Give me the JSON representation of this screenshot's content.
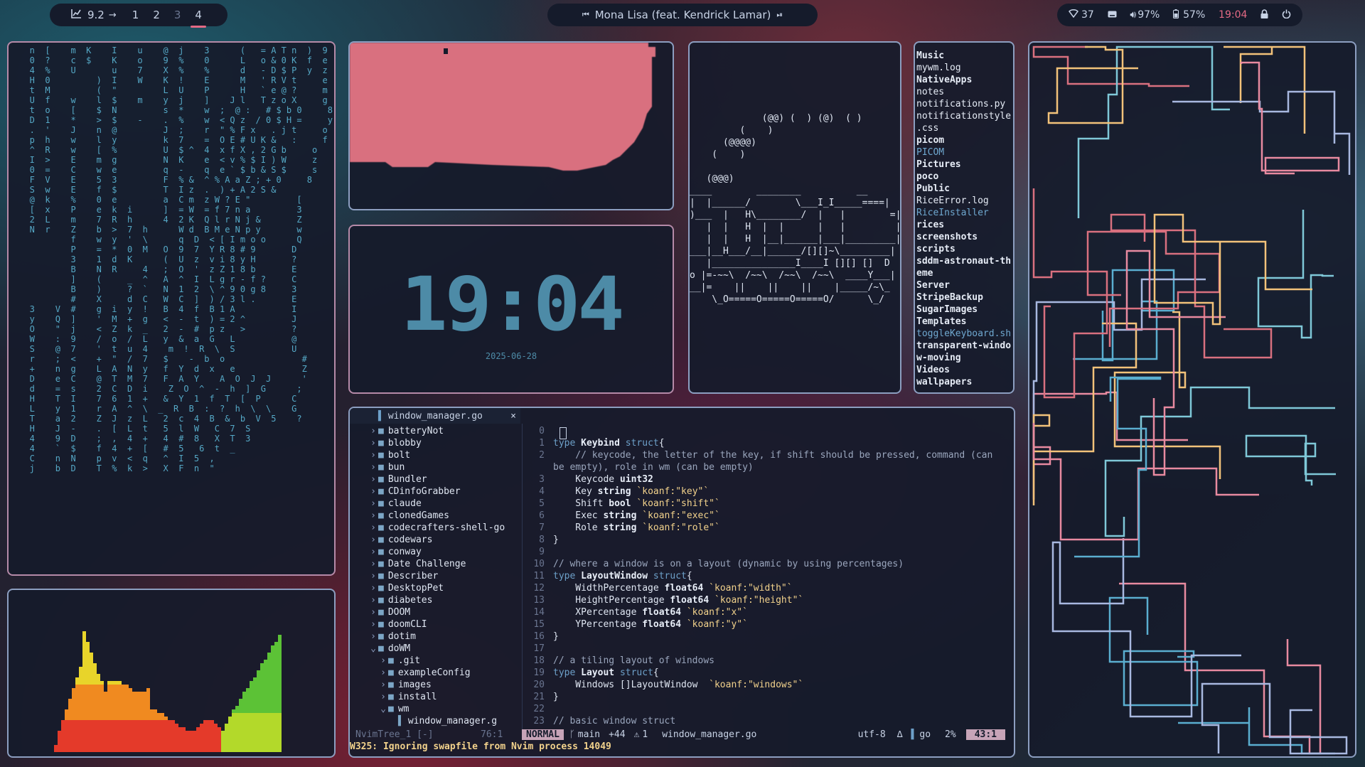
{
  "topbar": {
    "left": {
      "chart_icon": "chart-line-icon",
      "load": "9.2",
      "arrow": "→",
      "workspaces": [
        {
          "label": "1",
          "state": "normal"
        },
        {
          "label": "2",
          "state": "normal"
        },
        {
          "label": "3",
          "state": "dim"
        },
        {
          "label": "4",
          "state": "active"
        }
      ]
    },
    "media": {
      "prev_icon": "prev-track-icon",
      "title": "Mona Lisa (feat. Kendrick Lamar)",
      "next_icon": "play-next-icon"
    },
    "status": {
      "network_value": "37",
      "volume_value": "97%",
      "battery_value": "57%",
      "time": "19:04",
      "accent": "#e46a85"
    }
  },
  "matrix_lines": [
    "   n  [    m  K    I    u    @  j    3      (   = A T n  )  9",
    "   0  ?    c  $    K    o    9  %    0      L   o & 0 K  f  e",
    "   4  %    U       u    7    X  %    %      d   - D $ P  y  z",
    "   H  0         )  I    W    K  !    E      M   ' R V t     e",
    "   t  M         (  \"         L  U    P      H   ` e @ ?     m",
    "   U  f    w    l  $    m    y  j    ]    J l   T z o X     g",
    "   t  o    [    $  N         s  *    w  ;  @ :   # $ b 0     8",
    "   D  1    *    >  $    -    .  %    w  < Q z  / 0 $ H =     y",
    "   .  '    J    n  @         J  ;    r  \" % F x   . j t     o",
    "   p  h    w    l  y         k  7    =  O E # U K &   :     f",
    "   ^  R    w    [  %         U  $ ^  4  x f X , 2 G b     o",
    "   I  >    E    m  g         N  K    e  < v % $ I ) W     z",
    "   0  =    C    w  e         q  -    q  e ` $ b & S $     s",
    "   F  V    E    5  3         F  % &  ^ % A a Z ; + 0     8",
    "   S  w    E    f  $         T  I z  .  ) + A 2 S &",
    "   @  k    %    0  e         a  C m  z W ? E \"         [",
    "   [  x    P    e  k  i      ]  = W  = f 7 n a         3",
    "   2  L    m    7  R  h      4  2 K  Q l r N j &       Z",
    "   N  r    Z    b  >  7  h      W d  B M e N p y       w",
    "           f    w  y  '  \\      q  D  < [ I m o o      Q",
    "           P    =  *  0  M   O  9  7  Y R 8 # 9       D",
    "           3    1  d  K      (  U  z  v i 8 y H       ?",
    "           B    N  R     4   ;  O  '  z Z 1 8 b       E",
    "           ]    (     _  ^   A  ^  I  L g r - f ?     C",
    "           B    )     ?  `   N  1  2  \\ ^ 9 0 g 8     3",
    "           #    X     d  C   W  C  ]  ) / 3 l .       E",
    "   3    V  #    g  i  y  !   B  4  f  B 1 A           I",
    "   y    Q  ]    '  M  +  g   <  -  t  ) = 2 ^         J",
    "   O    \"  j    <  Z  k  _   2  -  #  p z   >         ?",
    "   W    :  9    /  o  /  L   y  &  a  G   L           @",
    "   S    @  7    '  t  u  4    m  !  R  \\  S           U",
    "   r    ;  <    +  \"  /  7   $    -  b  o               #",
    "   +    n  g    L  A  N  y   f  Y  d  x   e             Z",
    "   D    e  C    @  T  M  7   F  A  Y    A  O  J  J      '",
    "   d    =  s    2  C  D  i    Z  O  ^  -  h  ]  G      ;",
    "   H    T  I    7  6  1  +   &  Y  1  f  T  [  P      C",
    "   L    y  1    r  A  ^  \\  _  R  B  :  ?  h  \\  \\    G",
    "   T    a  2    Z  J  z  L   2  c  4  B  &  b  V  5    ?",
    "   H    J  -    .  [  L  t   5  l  W   C  7  S",
    "   4    9  D    ;  ,  4  +   4  #  8   X  T  3",
    "   4    `  $    f  4  +  [   #  5   6  t  _",
    "   C    n  N    p  v  <  q   ^  I  5  ,",
    "   j    b  D    T  %  k  >   X  F  n  \""
  ],
  "clock": {
    "time": "19:04",
    "date": "2025-06-28"
  },
  "ascii_art": [
    "",
    "",
    "             (@@) (  ) (@)  ( )",
    "         (    )",
    "      (@@@@)",
    "    (    )",
    "",
    "   (@@@)",
    "____        ________          __",
    "|  |______/        \\___I_I_____====|",
    ")___  |   H\\________/  |   |        =|",
    "   |  |   H  |  |      |   |         |",
    "   |  |   H  |__|______|___|_________|",
    "___|__H___/__|______/[][]~\\_________|",
    "   |_______________I____I [][] []  D  |",
    "o |=-~~\\  /~~\\  /~~\\  /~~\\  ____Y___|",
    "__|=    ||    ||    ||    |_____/~\\_",
    "    \\_O=====O=====O=====O/      \\_/"
  ],
  "file_list": [
    {
      "name": "Music",
      "style": "dir"
    },
    {
      "name": "mywm.log",
      "style": "plain"
    },
    {
      "name": "NativeApps",
      "style": "dir"
    },
    {
      "name": "notes",
      "style": "plain"
    },
    {
      "name": "notifications.py",
      "style": "plain"
    },
    {
      "name": "notificationstyle",
      "style": "plain"
    },
    {
      "name": ".css",
      "style": "plain"
    },
    {
      "name": "picom",
      "style": "dir"
    },
    {
      "name": "PICOM",
      "style": "hi"
    },
    {
      "name": "Pictures",
      "style": "dir"
    },
    {
      "name": "poco",
      "style": "dir"
    },
    {
      "name": "Public",
      "style": "dir"
    },
    {
      "name": "RiceError.log",
      "style": "plain"
    },
    {
      "name": "RiceInstaller",
      "style": "hi"
    },
    {
      "name": "rices",
      "style": "dir"
    },
    {
      "name": "screenshots",
      "style": "dir"
    },
    {
      "name": "scripts",
      "style": "dir"
    },
    {
      "name": "sddm-astronaut-th",
      "style": "dir"
    },
    {
      "name": "eme",
      "style": "dir"
    },
    {
      "name": "Server",
      "style": "dir"
    },
    {
      "name": "StripeBackup",
      "style": "dir"
    },
    {
      "name": "SugarImages",
      "style": "dir"
    },
    {
      "name": "Templates",
      "style": "dir"
    },
    {
      "name": "toggleKeyboard.sh",
      "style": "hi"
    },
    {
      "name": "transparent-windo",
      "style": "dir"
    },
    {
      "name": "w-moving",
      "style": "dir"
    },
    {
      "name": "Videos",
      "style": "dir"
    },
    {
      "name": "wallpapers",
      "style": "dir"
    }
  ],
  "editor": {
    "tab": {
      "file_icon": "go-file-icon",
      "label": "window_manager.go",
      "close": "×"
    },
    "tree": [
      {
        "label": "batteryNot",
        "depth": 0,
        "open": false
      },
      {
        "label": "blobby",
        "depth": 0,
        "open": false
      },
      {
        "label": "bolt",
        "depth": 0,
        "open": false
      },
      {
        "label": "bun",
        "depth": 0,
        "open": false
      },
      {
        "label": "Bundler",
        "depth": 0,
        "open": false
      },
      {
        "label": "CDinfoGrabber",
        "depth": 0,
        "open": false
      },
      {
        "label": "claude",
        "depth": 0,
        "open": false
      },
      {
        "label": "clonedGames",
        "depth": 0,
        "open": false
      },
      {
        "label": "codecrafters-shell-go",
        "depth": 0,
        "open": false
      },
      {
        "label": "codewars",
        "depth": 0,
        "open": false
      },
      {
        "label": "conway",
        "depth": 0,
        "open": false
      },
      {
        "label": "Date Challenge",
        "depth": 0,
        "open": false
      },
      {
        "label": "Describer",
        "depth": 0,
        "open": false
      },
      {
        "label": "DesktopPet",
        "depth": 0,
        "open": false
      },
      {
        "label": "diabetes",
        "depth": 0,
        "open": false
      },
      {
        "label": "DOOM",
        "depth": 0,
        "open": false
      },
      {
        "label": "doomCLI",
        "depth": 0,
        "open": false
      },
      {
        "label": "dotim",
        "depth": 0,
        "open": false
      },
      {
        "label": "doWM",
        "depth": 0,
        "open": true
      },
      {
        "label": ".git",
        "depth": 1,
        "open": false
      },
      {
        "label": "exampleConfig",
        "depth": 1,
        "open": false
      },
      {
        "label": "images",
        "depth": 1,
        "open": false
      },
      {
        "label": "install",
        "depth": 1,
        "open": false
      },
      {
        "label": "wm",
        "depth": 1,
        "open": true
      },
      {
        "label": "window_manager.g",
        "depth": 2,
        "open": false,
        "file": true
      }
    ],
    "code": [
      {
        "n": "0",
        "t": [
          [
            "tx",
            ""
          ]
        ]
      },
      {
        "n": "1",
        "t": [
          [
            "kw",
            "type "
          ],
          [
            "ty",
            "Keybind "
          ],
          [
            "kw",
            "struct"
          ],
          [
            "tx",
            "{"
          ]
        ]
      },
      {
        "n": "2",
        "t": [
          [
            "cm",
            "    // keycode, the letter of the key, if shift should be pressed, command (can"
          ]
        ]
      },
      {
        "n": "",
        "t": [
          [
            "cm",
            "be empty), role in wm (can be empty)"
          ]
        ]
      },
      {
        "n": "3",
        "t": [
          [
            "tx",
            "    Keycode "
          ],
          [
            "ty",
            "uint32"
          ]
        ]
      },
      {
        "n": "4",
        "t": [
          [
            "tx",
            "    Key "
          ],
          [
            "ty",
            "string "
          ],
          [
            "tg",
            "`koanf:\"key\"`"
          ]
        ]
      },
      {
        "n": "5",
        "t": [
          [
            "tx",
            "    Shift "
          ],
          [
            "ty",
            "bool "
          ],
          [
            "tg",
            "`koanf:\"shift\"`"
          ]
        ]
      },
      {
        "n": "6",
        "t": [
          [
            "tx",
            "    Exec "
          ],
          [
            "ty",
            "string "
          ],
          [
            "tg",
            "`koanf:\"exec\"`"
          ]
        ]
      },
      {
        "n": "7",
        "t": [
          [
            "tx",
            "    Role "
          ],
          [
            "ty",
            "string "
          ],
          [
            "tg",
            "`koanf:\"role\"`"
          ]
        ]
      },
      {
        "n": "8",
        "t": [
          [
            "tx",
            "}"
          ]
        ]
      },
      {
        "n": "9",
        "t": [
          [
            "tx",
            ""
          ]
        ]
      },
      {
        "n": "10",
        "t": [
          [
            "cm",
            "// where a window is on a layout (dynamic by using percentages)"
          ]
        ]
      },
      {
        "n": "11",
        "t": [
          [
            "kw",
            "type "
          ],
          [
            "ty",
            "LayoutWindow "
          ],
          [
            "kw",
            "struct"
          ],
          [
            "tx",
            "{"
          ]
        ]
      },
      {
        "n": "12",
        "t": [
          [
            "tx",
            "    WidthPercentage "
          ],
          [
            "ty",
            "float64 "
          ],
          [
            "tg",
            "`koanf:\"width\"`"
          ]
        ]
      },
      {
        "n": "13",
        "t": [
          [
            "tx",
            "    HeightPercentage "
          ],
          [
            "ty",
            "float64 "
          ],
          [
            "tg",
            "`koanf:\"height\"`"
          ]
        ]
      },
      {
        "n": "14",
        "t": [
          [
            "tx",
            "    XPercentage "
          ],
          [
            "ty",
            "float64 "
          ],
          [
            "tg",
            "`koanf:\"x\"`"
          ]
        ]
      },
      {
        "n": "15",
        "t": [
          [
            "tx",
            "    YPercentage "
          ],
          [
            "ty",
            "float64 "
          ],
          [
            "tg",
            "`koanf:\"y\"`"
          ]
        ]
      },
      {
        "n": "16",
        "t": [
          [
            "tx",
            "}"
          ]
        ]
      },
      {
        "n": "17",
        "t": [
          [
            "tx",
            ""
          ]
        ]
      },
      {
        "n": "18",
        "t": [
          [
            "cm",
            "// a tiling layout of windows"
          ]
        ]
      },
      {
        "n": "19",
        "t": [
          [
            "kw",
            "type "
          ],
          [
            "ty",
            "Layout "
          ],
          [
            "kw",
            "struct"
          ],
          [
            "tx",
            "{"
          ]
        ]
      },
      {
        "n": "20",
        "t": [
          [
            "tx",
            "    Windows "
          ],
          [
            "tx",
            "[]LayoutWindow  "
          ],
          [
            "tg",
            "`koanf:\"windows\"`"
          ]
        ]
      },
      {
        "n": "21",
        "t": [
          [
            "tx",
            "}"
          ]
        ]
      },
      {
        "n": "22",
        "t": [
          [
            "tx",
            ""
          ]
        ]
      },
      {
        "n": "23",
        "t": [
          [
            "cm",
            "// basic window struct"
          ]
        ]
      }
    ],
    "statusline": {
      "tree_name": "NvimTree_1 [-]",
      "tree_pos": "76:1",
      "mode": "NORMAL",
      "branch": "main",
      "added": "+44",
      "warnings": "1",
      "filename": "window_manager.go",
      "encoding": "utf-8",
      "filetype": "go",
      "percent": "2%",
      "position": "43:1"
    },
    "message": "W325: Ignoring swapfile from Nvim process 14049"
  },
  "colors": {
    "panel_bg": "#151b2b",
    "border": "#8c9ec0",
    "accent_pink": "#e46a85",
    "clock": "#4d8ba7",
    "pink_block": "#d9707f"
  }
}
